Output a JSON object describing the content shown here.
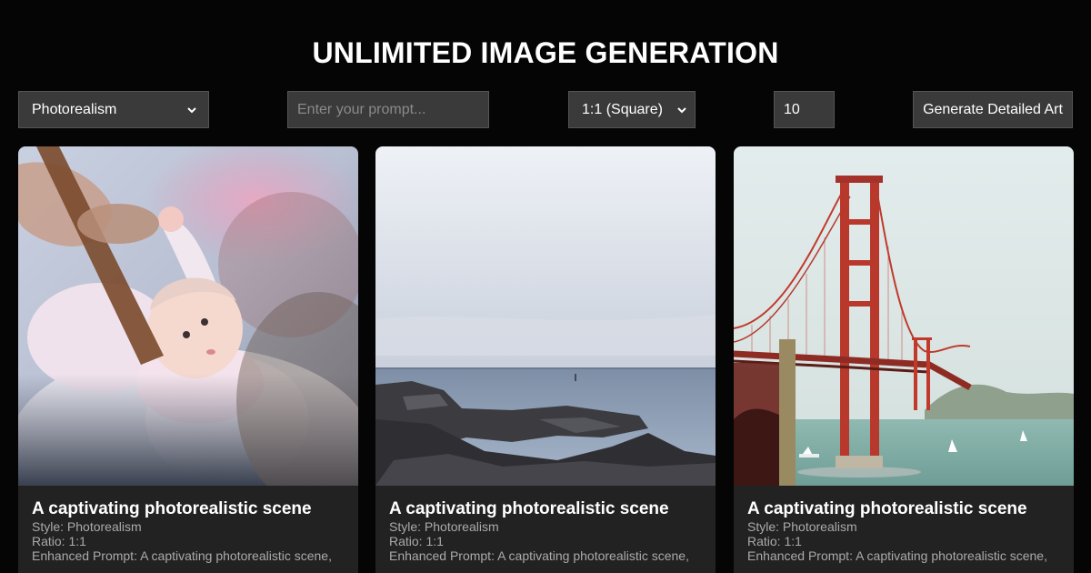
{
  "header": {
    "title": "UNLIMITED IMAGE GENERATION"
  },
  "controls": {
    "style_select": {
      "selected": "Photorealism"
    },
    "prompt_input": {
      "value": "",
      "placeholder": "Enter your prompt..."
    },
    "ratio_select": {
      "selected": "1:1 (Square)"
    },
    "count_input": {
      "value": "10"
    },
    "generate_button": {
      "label": "Generate Detailed Art"
    }
  },
  "cards": [
    {
      "image": "baby-photo",
      "title": "A captivating photorealistic scene",
      "style_line": "Style: Photorealism",
      "ratio_line": "Ratio: 1:1",
      "enhanced_line": "Enhanced Prompt: A captivating photorealistic scene,"
    },
    {
      "image": "rocky-coast-photo",
      "title": "A captivating photorealistic scene",
      "style_line": "Style: Photorealism",
      "ratio_line": "Ratio: 1:1",
      "enhanced_line": "Enhanced Prompt: A captivating photorealistic scene,"
    },
    {
      "image": "golden-gate-bridge-photo",
      "title": "A captivating photorealistic scene",
      "style_line": "Style: Photorealism",
      "ratio_line": "Ratio: 1:1",
      "enhanced_line": "Enhanced Prompt: A captivating photorealistic scene,"
    }
  ],
  "colors": {
    "background": "#050505",
    "card_background": "#222222",
    "control_background": "#3a3a3a",
    "meta_text": "#aaaaaa"
  }
}
